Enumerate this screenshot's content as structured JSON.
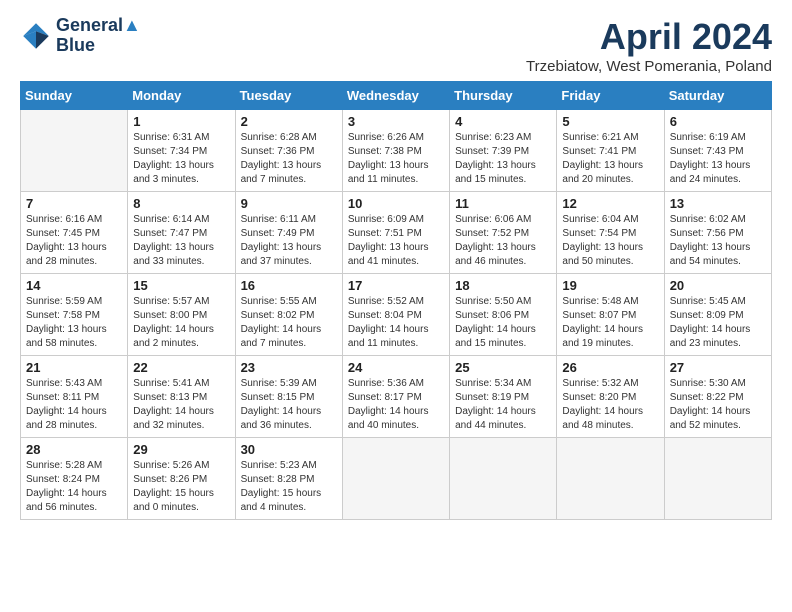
{
  "logo": {
    "line1": "General",
    "line2": "Blue"
  },
  "title": "April 2024",
  "subtitle": "Trzebiatow, West Pomerania, Poland",
  "days_of_week": [
    "Sunday",
    "Monday",
    "Tuesday",
    "Wednesday",
    "Thursday",
    "Friday",
    "Saturday"
  ],
  "weeks": [
    [
      {
        "num": "",
        "info": ""
      },
      {
        "num": "1",
        "info": "Sunrise: 6:31 AM\nSunset: 7:34 PM\nDaylight: 13 hours\nand 3 minutes."
      },
      {
        "num": "2",
        "info": "Sunrise: 6:28 AM\nSunset: 7:36 PM\nDaylight: 13 hours\nand 7 minutes."
      },
      {
        "num": "3",
        "info": "Sunrise: 6:26 AM\nSunset: 7:38 PM\nDaylight: 13 hours\nand 11 minutes."
      },
      {
        "num": "4",
        "info": "Sunrise: 6:23 AM\nSunset: 7:39 PM\nDaylight: 13 hours\nand 15 minutes."
      },
      {
        "num": "5",
        "info": "Sunrise: 6:21 AM\nSunset: 7:41 PM\nDaylight: 13 hours\nand 20 minutes."
      },
      {
        "num": "6",
        "info": "Sunrise: 6:19 AM\nSunset: 7:43 PM\nDaylight: 13 hours\nand 24 minutes."
      }
    ],
    [
      {
        "num": "7",
        "info": "Sunrise: 6:16 AM\nSunset: 7:45 PM\nDaylight: 13 hours\nand 28 minutes."
      },
      {
        "num": "8",
        "info": "Sunrise: 6:14 AM\nSunset: 7:47 PM\nDaylight: 13 hours\nand 33 minutes."
      },
      {
        "num": "9",
        "info": "Sunrise: 6:11 AM\nSunset: 7:49 PM\nDaylight: 13 hours\nand 37 minutes."
      },
      {
        "num": "10",
        "info": "Sunrise: 6:09 AM\nSunset: 7:51 PM\nDaylight: 13 hours\nand 41 minutes."
      },
      {
        "num": "11",
        "info": "Sunrise: 6:06 AM\nSunset: 7:52 PM\nDaylight: 13 hours\nand 46 minutes."
      },
      {
        "num": "12",
        "info": "Sunrise: 6:04 AM\nSunset: 7:54 PM\nDaylight: 13 hours\nand 50 minutes."
      },
      {
        "num": "13",
        "info": "Sunrise: 6:02 AM\nSunset: 7:56 PM\nDaylight: 13 hours\nand 54 minutes."
      }
    ],
    [
      {
        "num": "14",
        "info": "Sunrise: 5:59 AM\nSunset: 7:58 PM\nDaylight: 13 hours\nand 58 minutes."
      },
      {
        "num": "15",
        "info": "Sunrise: 5:57 AM\nSunset: 8:00 PM\nDaylight: 14 hours\nand 2 minutes."
      },
      {
        "num": "16",
        "info": "Sunrise: 5:55 AM\nSunset: 8:02 PM\nDaylight: 14 hours\nand 7 minutes."
      },
      {
        "num": "17",
        "info": "Sunrise: 5:52 AM\nSunset: 8:04 PM\nDaylight: 14 hours\nand 11 minutes."
      },
      {
        "num": "18",
        "info": "Sunrise: 5:50 AM\nSunset: 8:06 PM\nDaylight: 14 hours\nand 15 minutes."
      },
      {
        "num": "19",
        "info": "Sunrise: 5:48 AM\nSunset: 8:07 PM\nDaylight: 14 hours\nand 19 minutes."
      },
      {
        "num": "20",
        "info": "Sunrise: 5:45 AM\nSunset: 8:09 PM\nDaylight: 14 hours\nand 23 minutes."
      }
    ],
    [
      {
        "num": "21",
        "info": "Sunrise: 5:43 AM\nSunset: 8:11 PM\nDaylight: 14 hours\nand 28 minutes."
      },
      {
        "num": "22",
        "info": "Sunrise: 5:41 AM\nSunset: 8:13 PM\nDaylight: 14 hours\nand 32 minutes."
      },
      {
        "num": "23",
        "info": "Sunrise: 5:39 AM\nSunset: 8:15 PM\nDaylight: 14 hours\nand 36 minutes."
      },
      {
        "num": "24",
        "info": "Sunrise: 5:36 AM\nSunset: 8:17 PM\nDaylight: 14 hours\nand 40 minutes."
      },
      {
        "num": "25",
        "info": "Sunrise: 5:34 AM\nSunset: 8:19 PM\nDaylight: 14 hours\nand 44 minutes."
      },
      {
        "num": "26",
        "info": "Sunrise: 5:32 AM\nSunset: 8:20 PM\nDaylight: 14 hours\nand 48 minutes."
      },
      {
        "num": "27",
        "info": "Sunrise: 5:30 AM\nSunset: 8:22 PM\nDaylight: 14 hours\nand 52 minutes."
      }
    ],
    [
      {
        "num": "28",
        "info": "Sunrise: 5:28 AM\nSunset: 8:24 PM\nDaylight: 14 hours\nand 56 minutes."
      },
      {
        "num": "29",
        "info": "Sunrise: 5:26 AM\nSunset: 8:26 PM\nDaylight: 15 hours\nand 0 minutes."
      },
      {
        "num": "30",
        "info": "Sunrise: 5:23 AM\nSunset: 8:28 PM\nDaylight: 15 hours\nand 4 minutes."
      },
      {
        "num": "",
        "info": ""
      },
      {
        "num": "",
        "info": ""
      },
      {
        "num": "",
        "info": ""
      },
      {
        "num": "",
        "info": ""
      }
    ]
  ]
}
